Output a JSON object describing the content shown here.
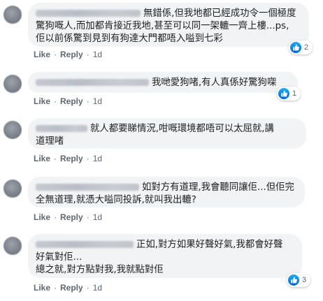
{
  "comments": [
    {
      "lines": [
        "無錯係,但我地都已經成功令一個極度",
        "驚狗嘅人,而加都肯接近我地,甚至可以同一架轆一齊上樓...ps,",
        "佢以前係驚到見到有狗達大門都唔入嗌到七彩"
      ],
      "like": "Like",
      "reply": "Reply",
      "time": "1d",
      "reactions": "2"
    },
    {
      "lines": [
        "我哋愛狗啫,有人真係好驚狗㗎"
      ],
      "like": "Like",
      "reply": "Reply",
      "time": "1d",
      "reactions": "1"
    },
    {
      "lines": [
        "就人都要睇情況,咁嘅環境都唔可以太屈就,講",
        "道理啫"
      ],
      "like": "Like",
      "reply": "Reply",
      "time": "1d",
      "reactions": ""
    },
    {
      "lines": [
        "如對方有道理,我會聽同讓佢...但佢完",
        "全無道理,就憑大嗌同投訴,就叫我出轆?"
      ],
      "like": "Like",
      "reply": "Reply",
      "time": "1d",
      "reactions": ""
    },
    {
      "lines": [
        "正如,對方如果好聲好氣,我都會好聲",
        "好氣對佢...",
        "總之就,對方點對我,我就點對佢"
      ],
      "like": "Like",
      "reply": "Reply",
      "time": "1d",
      "reactions": "3"
    }
  ],
  "icons": {
    "reaction": "thumbs-up-icon",
    "accent": "#1877f2"
  }
}
